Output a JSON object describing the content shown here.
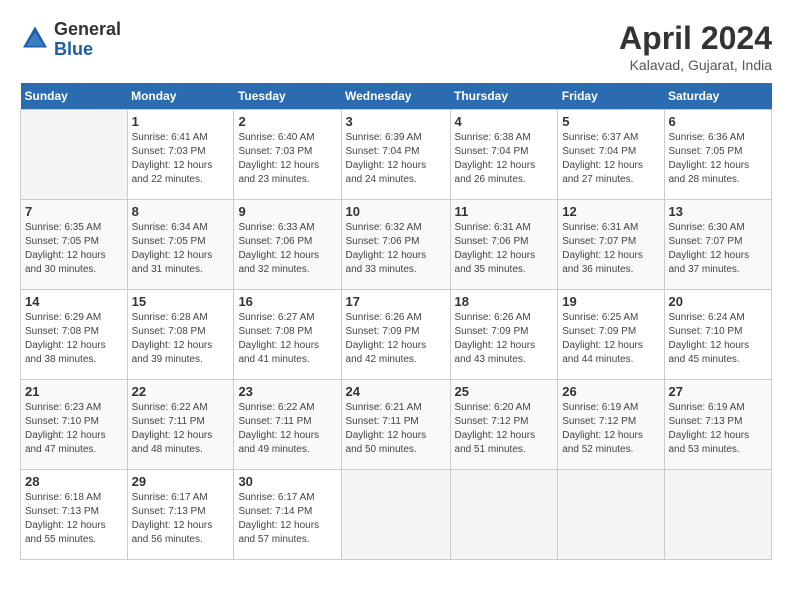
{
  "header": {
    "logo_general": "General",
    "logo_blue": "Blue",
    "month_title": "April 2024",
    "location": "Kalavad, Gujarat, India"
  },
  "weekdays": [
    "Sunday",
    "Monday",
    "Tuesday",
    "Wednesday",
    "Thursday",
    "Friday",
    "Saturday"
  ],
  "weeks": [
    [
      {
        "day": "",
        "sunrise": "",
        "sunset": "",
        "daylight": ""
      },
      {
        "day": "1",
        "sunrise": "Sunrise: 6:41 AM",
        "sunset": "Sunset: 7:03 PM",
        "daylight": "Daylight: 12 hours and 22 minutes."
      },
      {
        "day": "2",
        "sunrise": "Sunrise: 6:40 AM",
        "sunset": "Sunset: 7:03 PM",
        "daylight": "Daylight: 12 hours and 23 minutes."
      },
      {
        "day": "3",
        "sunrise": "Sunrise: 6:39 AM",
        "sunset": "Sunset: 7:04 PM",
        "daylight": "Daylight: 12 hours and 24 minutes."
      },
      {
        "day": "4",
        "sunrise": "Sunrise: 6:38 AM",
        "sunset": "Sunset: 7:04 PM",
        "daylight": "Daylight: 12 hours and 26 minutes."
      },
      {
        "day": "5",
        "sunrise": "Sunrise: 6:37 AM",
        "sunset": "Sunset: 7:04 PM",
        "daylight": "Daylight: 12 hours and 27 minutes."
      },
      {
        "day": "6",
        "sunrise": "Sunrise: 6:36 AM",
        "sunset": "Sunset: 7:05 PM",
        "daylight": "Daylight: 12 hours and 28 minutes."
      }
    ],
    [
      {
        "day": "7",
        "sunrise": "Sunrise: 6:35 AM",
        "sunset": "Sunset: 7:05 PM",
        "daylight": "Daylight: 12 hours and 30 minutes."
      },
      {
        "day": "8",
        "sunrise": "Sunrise: 6:34 AM",
        "sunset": "Sunset: 7:05 PM",
        "daylight": "Daylight: 12 hours and 31 minutes."
      },
      {
        "day": "9",
        "sunrise": "Sunrise: 6:33 AM",
        "sunset": "Sunset: 7:06 PM",
        "daylight": "Daylight: 12 hours and 32 minutes."
      },
      {
        "day": "10",
        "sunrise": "Sunrise: 6:32 AM",
        "sunset": "Sunset: 7:06 PM",
        "daylight": "Daylight: 12 hours and 33 minutes."
      },
      {
        "day": "11",
        "sunrise": "Sunrise: 6:31 AM",
        "sunset": "Sunset: 7:06 PM",
        "daylight": "Daylight: 12 hours and 35 minutes."
      },
      {
        "day": "12",
        "sunrise": "Sunrise: 6:31 AM",
        "sunset": "Sunset: 7:07 PM",
        "daylight": "Daylight: 12 hours and 36 minutes."
      },
      {
        "day": "13",
        "sunrise": "Sunrise: 6:30 AM",
        "sunset": "Sunset: 7:07 PM",
        "daylight": "Daylight: 12 hours and 37 minutes."
      }
    ],
    [
      {
        "day": "14",
        "sunrise": "Sunrise: 6:29 AM",
        "sunset": "Sunset: 7:08 PM",
        "daylight": "Daylight: 12 hours and 38 minutes."
      },
      {
        "day": "15",
        "sunrise": "Sunrise: 6:28 AM",
        "sunset": "Sunset: 7:08 PM",
        "daylight": "Daylight: 12 hours and 39 minutes."
      },
      {
        "day": "16",
        "sunrise": "Sunrise: 6:27 AM",
        "sunset": "Sunset: 7:08 PM",
        "daylight": "Daylight: 12 hours and 41 minutes."
      },
      {
        "day": "17",
        "sunrise": "Sunrise: 6:26 AM",
        "sunset": "Sunset: 7:09 PM",
        "daylight": "Daylight: 12 hours and 42 minutes."
      },
      {
        "day": "18",
        "sunrise": "Sunrise: 6:26 AM",
        "sunset": "Sunset: 7:09 PM",
        "daylight": "Daylight: 12 hours and 43 minutes."
      },
      {
        "day": "19",
        "sunrise": "Sunrise: 6:25 AM",
        "sunset": "Sunset: 7:09 PM",
        "daylight": "Daylight: 12 hours and 44 minutes."
      },
      {
        "day": "20",
        "sunrise": "Sunrise: 6:24 AM",
        "sunset": "Sunset: 7:10 PM",
        "daylight": "Daylight: 12 hours and 45 minutes."
      }
    ],
    [
      {
        "day": "21",
        "sunrise": "Sunrise: 6:23 AM",
        "sunset": "Sunset: 7:10 PM",
        "daylight": "Daylight: 12 hours and 47 minutes."
      },
      {
        "day": "22",
        "sunrise": "Sunrise: 6:22 AM",
        "sunset": "Sunset: 7:11 PM",
        "daylight": "Daylight: 12 hours and 48 minutes."
      },
      {
        "day": "23",
        "sunrise": "Sunrise: 6:22 AM",
        "sunset": "Sunset: 7:11 PM",
        "daylight": "Daylight: 12 hours and 49 minutes."
      },
      {
        "day": "24",
        "sunrise": "Sunrise: 6:21 AM",
        "sunset": "Sunset: 7:11 PM",
        "daylight": "Daylight: 12 hours and 50 minutes."
      },
      {
        "day": "25",
        "sunrise": "Sunrise: 6:20 AM",
        "sunset": "Sunset: 7:12 PM",
        "daylight": "Daylight: 12 hours and 51 minutes."
      },
      {
        "day": "26",
        "sunrise": "Sunrise: 6:19 AM",
        "sunset": "Sunset: 7:12 PM",
        "daylight": "Daylight: 12 hours and 52 minutes."
      },
      {
        "day": "27",
        "sunrise": "Sunrise: 6:19 AM",
        "sunset": "Sunset: 7:13 PM",
        "daylight": "Daylight: 12 hours and 53 minutes."
      }
    ],
    [
      {
        "day": "28",
        "sunrise": "Sunrise: 6:18 AM",
        "sunset": "Sunset: 7:13 PM",
        "daylight": "Daylight: 12 hours and 55 minutes."
      },
      {
        "day": "29",
        "sunrise": "Sunrise: 6:17 AM",
        "sunset": "Sunset: 7:13 PM",
        "daylight": "Daylight: 12 hours and 56 minutes."
      },
      {
        "day": "30",
        "sunrise": "Sunrise: 6:17 AM",
        "sunset": "Sunset: 7:14 PM",
        "daylight": "Daylight: 12 hours and 57 minutes."
      },
      {
        "day": "",
        "sunrise": "",
        "sunset": "",
        "daylight": ""
      },
      {
        "day": "",
        "sunrise": "",
        "sunset": "",
        "daylight": ""
      },
      {
        "day": "",
        "sunrise": "",
        "sunset": "",
        "daylight": ""
      },
      {
        "day": "",
        "sunrise": "",
        "sunset": "",
        "daylight": ""
      }
    ]
  ]
}
